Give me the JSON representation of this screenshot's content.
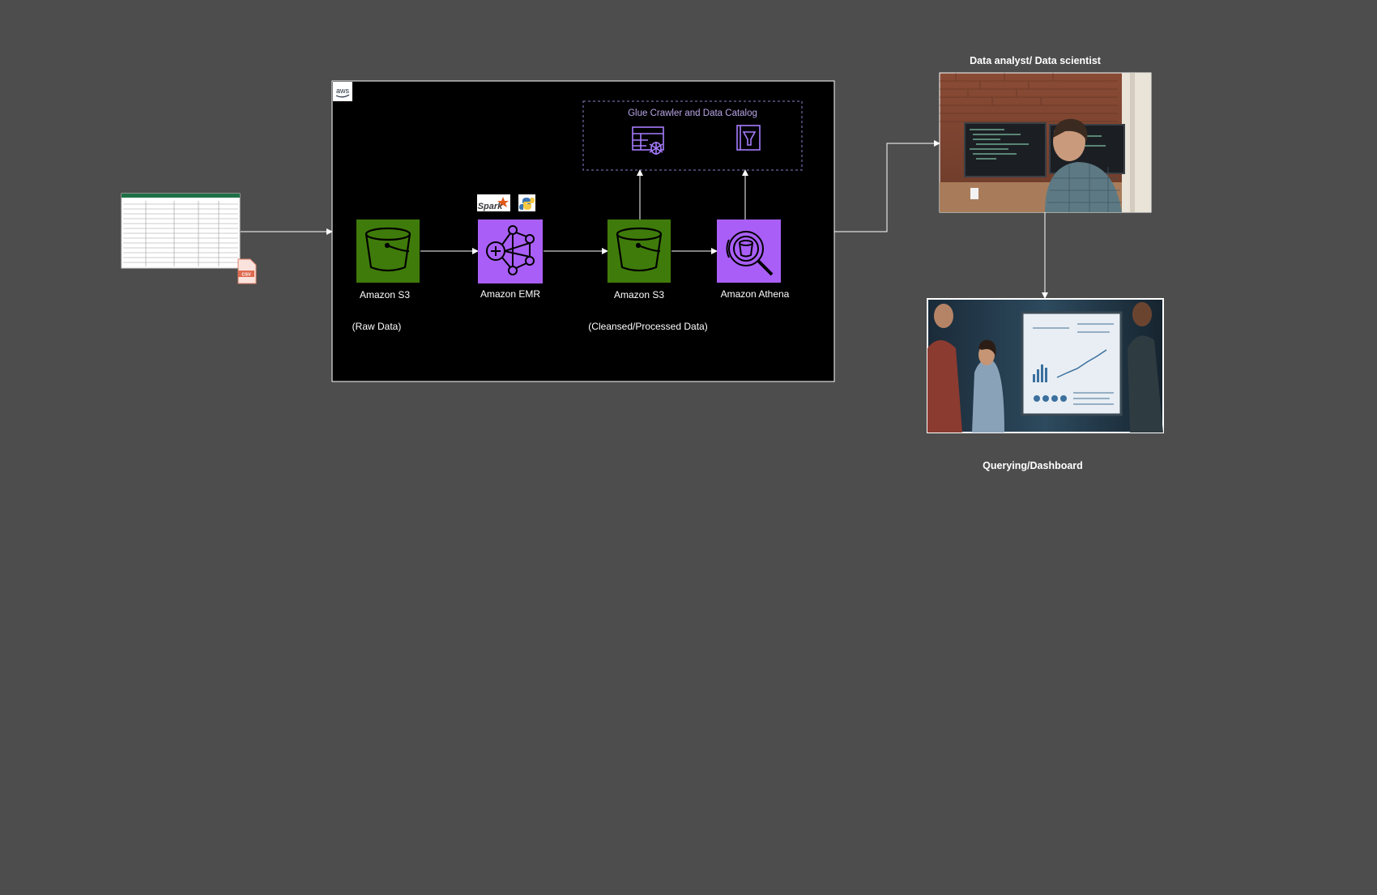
{
  "diagram": {
    "aws_cloud": {
      "logo_text": "aws",
      "glue_group_title": "Glue Crawler and Data Catalog"
    },
    "nodes": {
      "s3_raw_label": "Amazon S3",
      "s3_raw_sublabel": "(Raw Data)",
      "emr_label": "Amazon EMR",
      "spark_logo_text": "Spark",
      "s3_processed_label": "Amazon S3",
      "s3_processed_sublabel": "(Cleansed/Processed Data)",
      "athena_label": "Amazon Athena",
      "csv_badge_text": "CSV"
    },
    "consumers": {
      "analyst_title": "Data analyst/ Data scientist",
      "dashboard_title": "Querying/Dashboard"
    },
    "icons": {
      "source": "spreadsheet-csv-icon",
      "s3": "s3-bucket-icon",
      "emr": "emr-cluster-icon",
      "athena": "athena-search-icon",
      "glue_crawler": "glue-crawler-icon",
      "data_catalog": "data-catalog-icon",
      "spark": "spark-logo-icon",
      "python": "python-logo-icon",
      "analyst_photo": "analyst-photo",
      "dashboard_photo": "dashboard-photo"
    },
    "colors": {
      "background": "#4d4d4d",
      "aws_panel": "#000000",
      "s3_green": "#3f7b0a",
      "analytics_purple": "#a95ff7",
      "glue_purple": "#8c4fff",
      "arrow": "#ffffff"
    }
  }
}
